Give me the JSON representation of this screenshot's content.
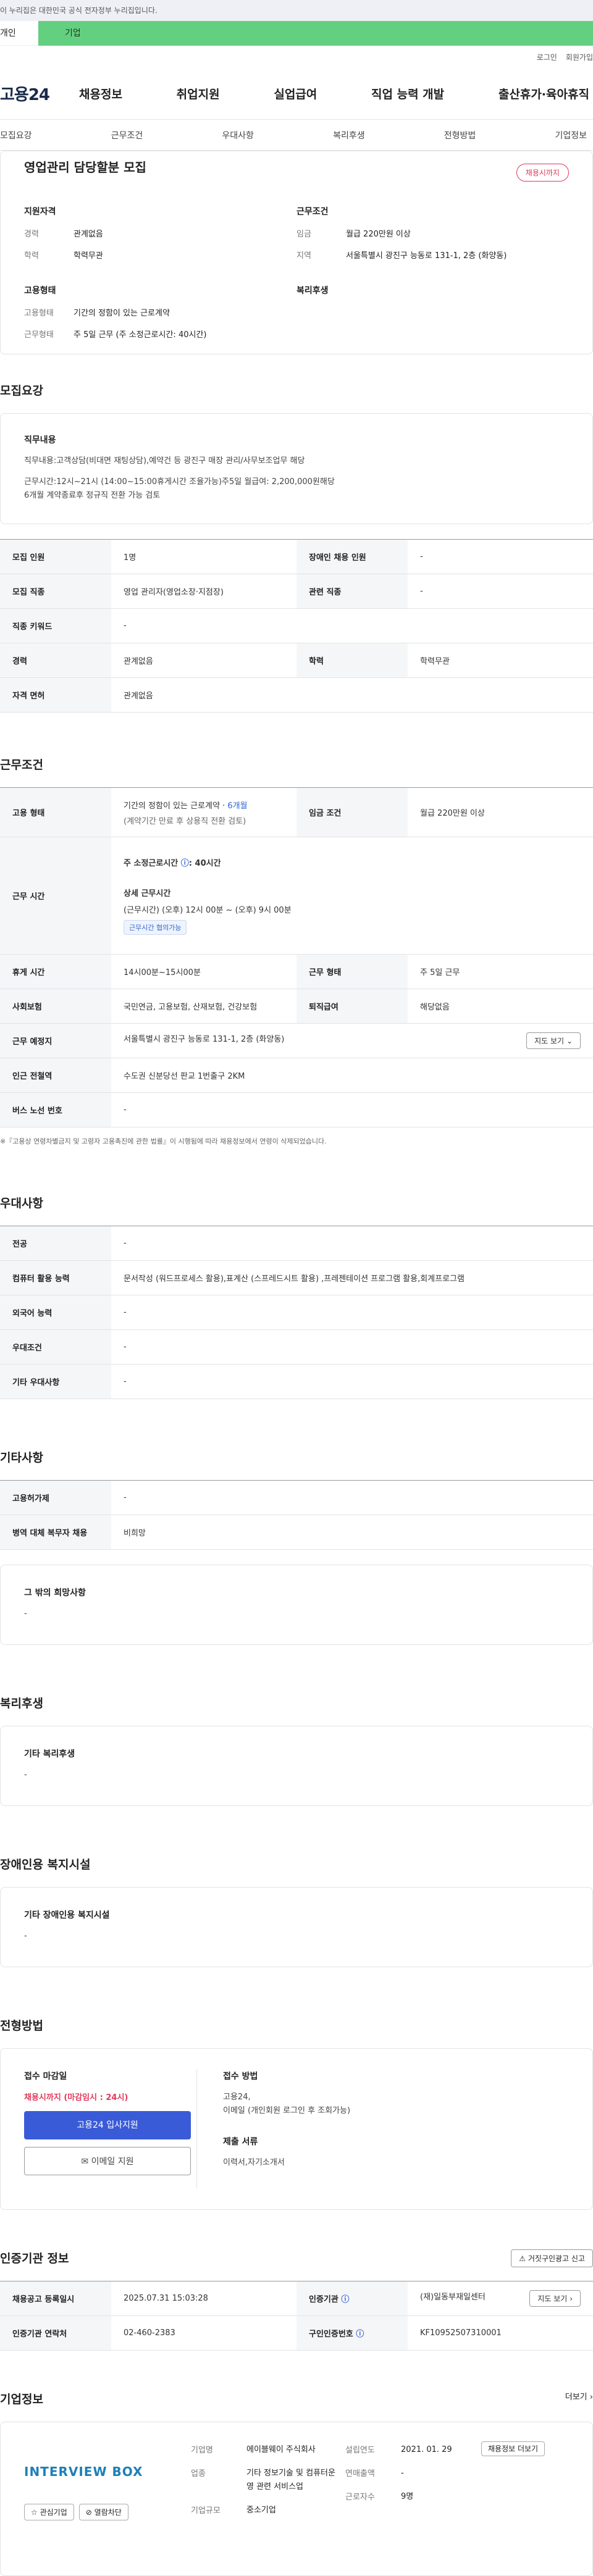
{
  "banner": "이 누리집은 대한민국 공식 전자정부 누리집입니다.",
  "user_tabs": {
    "personal": "개인",
    "company": "기업"
  },
  "util": {
    "login": "로그인",
    "join": "회원가입"
  },
  "gnb": {
    "logo": "고용24",
    "menu": [
      "채용정보",
      "취업지원",
      "실업급여",
      "직업 능력 개발",
      "출산휴가·육아휴직"
    ]
  },
  "subnav": [
    "모집요강",
    "근무조건",
    "우대사항",
    "복리후생",
    "전형방법",
    "기업정보"
  ],
  "summary": {
    "title": "영업관리 담당할분 모집",
    "status": "채용시까지",
    "qual_head": "지원자격",
    "qual_rows": [
      {
        "k": "경력",
        "v": "관계없음"
      },
      {
        "k": "학력",
        "v": "학력무관"
      }
    ],
    "cond_head": "근무조건",
    "cond_rows": [
      {
        "k": "임금",
        "v": "월급 220만원 이상"
      },
      {
        "k": "지역",
        "v": "서울특별시 광진구 능동로 131-1, 2층 (화양동)"
      }
    ],
    "emp_head": "고용형태",
    "emp_rows": [
      {
        "k": "고용형태",
        "v": "기간의 정함이 있는 근로계약"
      },
      {
        "k": "근무형태",
        "v": "주 5일 근무 (주 소정근로시간: 40시간)"
      }
    ],
    "welfare_head": "복리후생"
  },
  "recruit": {
    "title": "모집요강",
    "jd_head": "직무내용",
    "jd_lines": [
      "직무내용:고객상담(비대면 재팅상담),예약건 등  광진구 매장 관리/사무보조업무 해당",
      "근무시간:12시~21시 (14:00~15:00휴게시간 조율가능)주5일 월급여: 2,200,000원해당",
      "6개월 계약종료후 정규직 전환 가능 검토"
    ],
    "rows": [
      {
        "k1": "모집 인원",
        "v1": "1명",
        "k2": "장애인 채용 인원",
        "v2": "-"
      },
      {
        "k1": "모집 직종",
        "v1": "영업 관리자(영업소장·지점장)",
        "k2": "관련 직종",
        "v2": "-"
      },
      {
        "k1": "직종 키워드",
        "v1": "-",
        "k2": "",
        "v2": ""
      },
      {
        "k1": "경력",
        "v1": "관계없음",
        "k2": "학력",
        "v2": "학력무관"
      },
      {
        "k1": "자격 면허",
        "v1": "관계없음",
        "k2": "",
        "v2": ""
      }
    ]
  },
  "conditions": {
    "title": "근무조건",
    "emp_type_k": "고용 형태",
    "emp_type_v1": "기간의 정함이 있는 근로계약 · ",
    "emp_type_v1b": "6개월",
    "emp_type_v2": "(계약기간 만료 후 상용직 전환 검토)",
    "wage_k": "임금 조건",
    "wage_v": "월급 220만원 이상",
    "hours_k": "근무 시간",
    "hours_v1": "주 소정근로시간 ",
    "hours_v1b": ": 40시간",
    "hours_detail_head": "상세 근무시간",
    "hours_detail": "(근무시간) (오후) 12시 00분 ~ (오후) 9시 00분",
    "hours_chip": "근무시간 협의가능",
    "rows": [
      {
        "k1": "휴게 시간",
        "v1": "14시00분~15시00분",
        "k2": "근무 형태",
        "v2": "주 5일 근무"
      },
      {
        "k1": "사회보험",
        "v1": "국민연금, 고용보험, 산재보험, 건강보험",
        "k2": "퇴직급여",
        "v2": "해당없음"
      }
    ],
    "loc_k": "근무 예정지",
    "loc_v": "서울특별시 광진구 능동로 131-1, 2층 (화양동)",
    "map_btn": "지도 보기",
    "station_k": "인근 전철역",
    "station_v": "수도권 신분당선 판교 1번출구 2KM",
    "bus_k": "버스 노선 번호",
    "bus_v": "-",
    "note": "※『고용상 연령차별금지 및 고령자 고용촉진에 관한 법률』이 시행됨에 따라 채용정보에서 연령이 삭제되었습니다."
  },
  "preference": {
    "title": "우대사항",
    "rows": [
      {
        "k": "전공",
        "v": "-"
      },
      {
        "k": "컴퓨터 활용 능력",
        "v": "문서작성 (워드프로세스 활용),표계산 (스프레드시트 활용) ,프레젠테이션 프로그램 활용,회계프로그램"
      },
      {
        "k": "외국어 능력",
        "v": "-"
      },
      {
        "k": "우대조건",
        "v": "-"
      },
      {
        "k": "기타 우대사항",
        "v": "-"
      }
    ]
  },
  "other": {
    "title": "기타사항",
    "rows": [
      {
        "k": "고용허가제",
        "v": "-"
      },
      {
        "k": "병역 대체 복무자 채용",
        "v": "비희망"
      }
    ],
    "wish_head": "그 밖의 희망사항",
    "wish_v": "-"
  },
  "welfare": {
    "title": "복리후생",
    "head": "기타 복리후생",
    "v": "-"
  },
  "disability": {
    "title": "장애인용 복지시설",
    "head": "기타 장애인용 복지시설",
    "v": "-"
  },
  "apply": {
    "title": "전형방법",
    "deadline_head": "접수 마감일",
    "deadline_v": "채용시까지 (마감임시 : 24시)",
    "btn_primary": "고용24 입사지원",
    "btn_email": "이메일 지원",
    "method_head": "접수 방법",
    "method_v1": "고용24,",
    "method_v2": "이메일 (개인회원 로그인 후 조회가능)",
    "docs_head": "제출 서류",
    "docs_v": "이력서,자기소개서"
  },
  "cert": {
    "title": "인증기관 정보",
    "report_btn": "거짓구인광고 신고",
    "rows": [
      {
        "k1": "채용공고 등록일시",
        "v1": "2025.07.31 15:03:28",
        "k2": "인증기관",
        "v2": "(재)일동부재일센터"
      },
      {
        "k1": "인증기관 연락처",
        "v1": "02-460-2383",
        "k2": "구인인증번호",
        "v2": "KF10952507310001"
      }
    ],
    "map_btn": "지도 보기"
  },
  "company": {
    "title": "기업정보",
    "more": "더보기",
    "logo": "INTERVIEW BOX",
    "fav_btn": "관심기업",
    "block_btn": "열람차단",
    "name_k": "기업명",
    "name_v": "에이블웨이 주식회사",
    "biz_k": "업종",
    "biz_v": "기타 정보기술 및 컴퓨터운영 관련 서비스업",
    "scale_k": "기업규모",
    "scale_v": "중소기업",
    "est_k": "설립연도",
    "est_v": "2021. 01. 29",
    "sales_k": "연매출액",
    "sales_v": "-",
    "staff_k": "근로자수",
    "staff_v": "9명",
    "jobs_btn": "채용정보 더보기"
  }
}
